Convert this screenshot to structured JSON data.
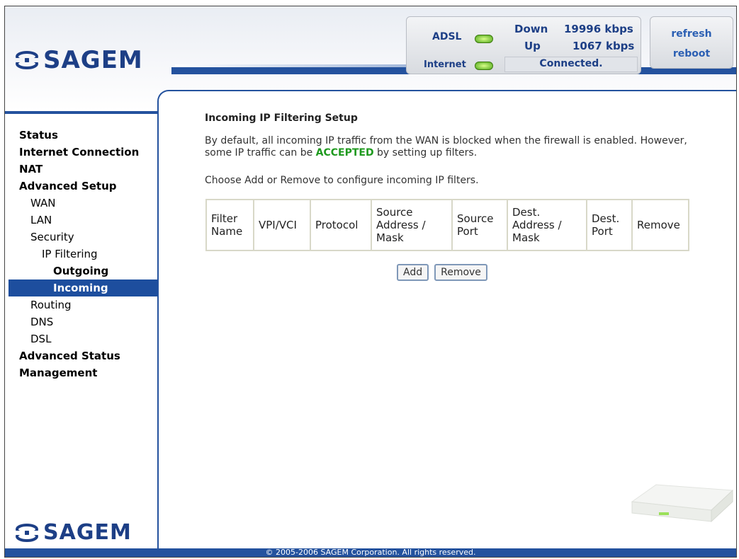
{
  "brand": {
    "name": "SAGEM",
    "color": "#1d3f86"
  },
  "status": {
    "adsl_label": "ADSL",
    "internet_label": "Internet",
    "down_label": "Down",
    "down_value": "19996 kbps",
    "up_label": "Up",
    "up_value": "1067 kbps",
    "connection": "Connected.",
    "led_color": "#4ea61a"
  },
  "header_buttons": {
    "refresh": "refresh",
    "reboot": "reboot"
  },
  "nav": {
    "items": [
      {
        "label": "Status",
        "level": 0
      },
      {
        "label": "Internet Connection",
        "level": 0
      },
      {
        "label": "NAT",
        "level": 0
      },
      {
        "label": "Advanced Setup",
        "level": 0
      },
      {
        "label": "WAN",
        "level": 1
      },
      {
        "label": "LAN",
        "level": 1
      },
      {
        "label": "Security",
        "level": 1
      },
      {
        "label": "IP Filtering",
        "level": 2
      },
      {
        "label": "Outgoing",
        "level": 3
      },
      {
        "label": "Incoming",
        "level": 3,
        "active": true
      },
      {
        "label": "Routing",
        "level": 1
      },
      {
        "label": "DNS",
        "level": 1
      },
      {
        "label": "DSL",
        "level": 1
      },
      {
        "label": "Advanced Status",
        "level": 0
      },
      {
        "label": "Management",
        "level": 0
      }
    ],
    "active_color": "#1d4e9e"
  },
  "main": {
    "title": "Incoming IP Filtering Setup",
    "para1_a": "By default, all incoming IP traffic from the WAN is blocked when the firewall is enabled. However, some IP traffic can be ",
    "para1_b": "ACCEPTED",
    "para1_c": " by setting up filters.",
    "para2": "Choose Add or Remove to configure incoming IP filters.",
    "table": {
      "headers": [
        "Filter Name",
        "VPI/VCI",
        "Protocol",
        "Source Address / Mask",
        "Source Port",
        "Dest. Address / Mask",
        "Dest. Port",
        "Remove"
      ]
    },
    "add_label": "Add",
    "remove_label": "Remove"
  },
  "footer": {
    "text": "© 2005-2006 SAGEM Corporation. All rights reserved."
  }
}
